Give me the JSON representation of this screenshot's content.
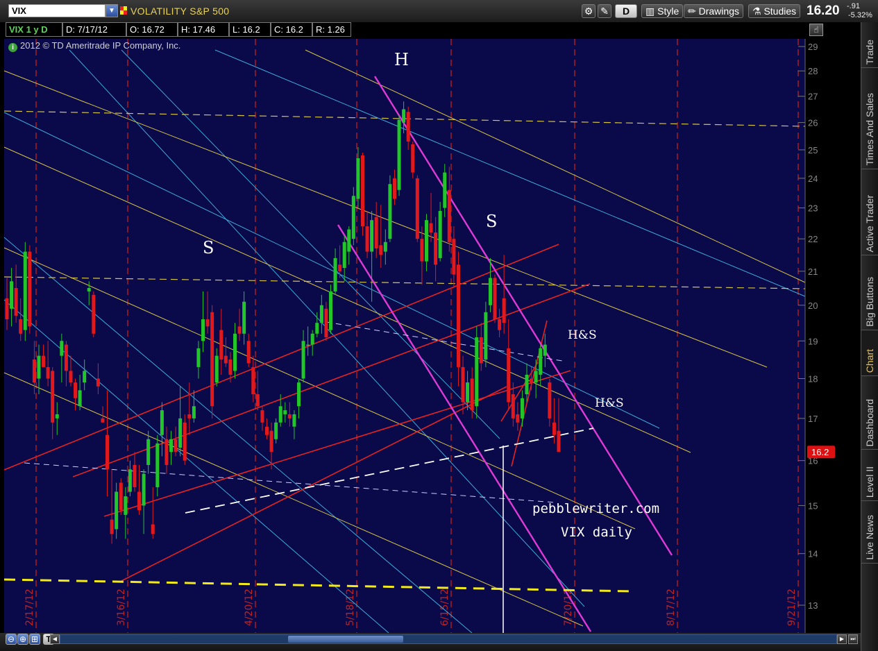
{
  "toolbar": {
    "symbol": "VIX",
    "symbol_description": "VOLATILITY S&P 500",
    "aggregation": "D",
    "style_label": "Style",
    "drawings_label": "Drawings",
    "studies_label": "Studies",
    "last_price": "16.20",
    "net_change": "-.91",
    "pct_change": "-5.32%"
  },
  "info_bar": {
    "period": "VIX 1 y D",
    "date": "D: 7/17/12",
    "open": "O: 16.72",
    "high": "H: 17.46",
    "low": "L: 16.2",
    "close": "C: 16.2",
    "range": "R: 1.26"
  },
  "copyright": "2012 © TD Ameritrade IP Company, Inc.",
  "sidebar_tabs": [
    {
      "label": "Trade",
      "active": false
    },
    {
      "label": "Times And Sales",
      "active": false
    },
    {
      "label": "Active Trader",
      "active": false
    },
    {
      "label": "Big Buttons",
      "active": false
    },
    {
      "label": "Chart",
      "active": true
    },
    {
      "label": "Dashboard",
      "active": false
    },
    {
      "label": "Level II",
      "active": false
    },
    {
      "label": "Live News",
      "active": false
    }
  ],
  "chart_data": {
    "type": "candlestick",
    "y_axis": {
      "min": 13,
      "max": 29,
      "scale": "log",
      "ticks": [
        13,
        14,
        15,
        16,
        17,
        18,
        19,
        20,
        21,
        22,
        23,
        24,
        25,
        26,
        27,
        28,
        29
      ]
    },
    "x_axis": {
      "month_labels": [
        "Mar",
        "Apr",
        "May",
        "Jun",
        "Jul",
        "Aug",
        "Sep"
      ]
    },
    "expiration_dates": [
      "2/17/12",
      "3/16/12",
      "4/20/12",
      "5/18/12",
      "6/15/12",
      "7/20/12",
      "8/17/12",
      "9/21/12"
    ],
    "current_price_label": "16.2",
    "candles": [
      {
        "o": 20.2,
        "h": 20.8,
        "l": 19.3,
        "c": 19.6
      },
      {
        "o": 19.9,
        "h": 21.1,
        "l": 19.4,
        "c": 20.7
      },
      {
        "o": 20.5,
        "h": 21.2,
        "l": 19.5,
        "c": 19.7
      },
      {
        "o": 19.6,
        "h": 20.2,
        "l": 19.0,
        "c": 19.2
      },
      {
        "o": 19.3,
        "h": 21.9,
        "l": 19.0,
        "c": 21.6
      },
      {
        "o": 21.6,
        "h": 21.8,
        "l": 19.2,
        "c": 19.4
      },
      {
        "o": 18.5,
        "h": 19.0,
        "l": 17.6,
        "c": 17.9
      },
      {
        "o": 18.0,
        "h": 18.9,
        "l": 17.6,
        "c": 18.6
      },
      {
        "o": 18.6,
        "h": 18.9,
        "l": 18.3,
        "c": 18.3
      },
      {
        "o": 18.3,
        "h": 19.0,
        "l": 17.8,
        "c": 18.0
      },
      {
        "o": 18.2,
        "h": 18.3,
        "l": 16.5,
        "c": 16.9
      },
      {
        "o": 17.0,
        "h": 17.4,
        "l": 16.6,
        "c": 17.1
      },
      {
        "o": 18.6,
        "h": 19.2,
        "l": 17.9,
        "c": 19.0
      },
      {
        "o": 18.9,
        "h": 19.0,
        "l": 17.8,
        "c": 18.2
      },
      {
        "o": 18.2,
        "h": 18.6,
        "l": 17.8,
        "c": 17.9
      },
      {
        "o": 17.9,
        "h": 18.0,
        "l": 17.2,
        "c": 17.5
      },
      {
        "o": 17.3,
        "h": 18.1,
        "l": 17.2,
        "c": 17.7
      },
      {
        "o": 17.9,
        "h": 18.5,
        "l": 17.7,
        "c": 18.2
      },
      {
        "o": 20.4,
        "h": 20.7,
        "l": 20.0,
        "c": 20.5
      },
      {
        "o": 20.3,
        "h": 20.4,
        "l": 19.1,
        "c": 19.2
      },
      {
        "o": 18.0,
        "h": 18.4,
        "l": 17.6,
        "c": 17.8
      },
      {
        "o": 17.0,
        "h": 17.3,
        "l": 16.9,
        "c": 16.9
      },
      {
        "o": 16.6,
        "h": 17.7,
        "l": 15.2,
        "c": 15.8
      },
      {
        "o": 14.7,
        "h": 15.8,
        "l": 14.2,
        "c": 14.4
      },
      {
        "o": 14.5,
        "h": 15.5,
        "l": 14.3,
        "c": 15.3
      },
      {
        "o": 15.5,
        "h": 15.6,
        "l": 14.8,
        "c": 14.9
      },
      {
        "o": 14.8,
        "h": 15.4,
        "l": 14.3,
        "c": 15.2
      },
      {
        "o": 15.3,
        "h": 16.0,
        "l": 15.2,
        "c": 15.8
      },
      {
        "o": 15.9,
        "h": 16.2,
        "l": 15.3,
        "c": 15.4
      },
      {
        "o": 15.3,
        "h": 15.9,
        "l": 14.8,
        "c": 14.9
      },
      {
        "o": 15.0,
        "h": 15.8,
        "l": 14.4,
        "c": 15.7
      },
      {
        "o": 15.9,
        "h": 16.7,
        "l": 15.7,
        "c": 16.5
      },
      {
        "o": 14.6,
        "h": 15.4,
        "l": 14.3,
        "c": 14.4
      },
      {
        "o": 15.4,
        "h": 16.6,
        "l": 15.2,
        "c": 16.4
      },
      {
        "o": 16.6,
        "h": 17.4,
        "l": 16.1,
        "c": 17.2
      },
      {
        "o": 16.5,
        "h": 16.8,
        "l": 15.7,
        "c": 15.9
      },
      {
        "o": 16.2,
        "h": 16.7,
        "l": 15.9,
        "c": 16.5
      },
      {
        "o": 16.5,
        "h": 16.8,
        "l": 16.1,
        "c": 16.2
      },
      {
        "o": 16.3,
        "h": 17.8,
        "l": 16.1,
        "c": 17.0
      },
      {
        "o": 16.9,
        "h": 17.1,
        "l": 15.9,
        "c": 16.0
      },
      {
        "o": 17.1,
        "h": 17.9,
        "l": 16.6,
        "c": 17.0
      },
      {
        "o": 17.0,
        "h": 17.7,
        "l": 16.9,
        "c": 17.3
      },
      {
        "o": 18.3,
        "h": 19.0,
        "l": 18.0,
        "c": 18.8
      },
      {
        "o": 19.0,
        "h": 20.4,
        "l": 18.7,
        "c": 19.6
      },
      {
        "o": 19.6,
        "h": 20.4,
        "l": 19.2,
        "c": 19.4
      },
      {
        "o": 19.8,
        "h": 20.0,
        "l": 17.0,
        "c": 17.3
      },
      {
        "o": 17.9,
        "h": 18.8,
        "l": 17.8,
        "c": 18.6
      },
      {
        "o": 19.3,
        "h": 19.9,
        "l": 18.1,
        "c": 18.5
      },
      {
        "o": 18.6,
        "h": 19.1,
        "l": 18.3,
        "c": 18.4
      },
      {
        "o": 18.5,
        "h": 18.7,
        "l": 17.9,
        "c": 18.1
      },
      {
        "o": 18.2,
        "h": 19.5,
        "l": 18.0,
        "c": 19.2
      },
      {
        "o": 19.4,
        "h": 19.9,
        "l": 19.0,
        "c": 19.2
      },
      {
        "o": 19.2,
        "h": 20.4,
        "l": 18.9,
        "c": 20.1
      },
      {
        "o": 19.0,
        "h": 19.2,
        "l": 18.3,
        "c": 18.4
      },
      {
        "o": 18.3,
        "h": 18.6,
        "l": 17.4,
        "c": 17.6
      },
      {
        "o": 17.6,
        "h": 18.2,
        "l": 17.2,
        "c": 17.3
      },
      {
        "o": 17.2,
        "h": 17.3,
        "l": 16.7,
        "c": 16.9
      },
      {
        "o": 16.8,
        "h": 17.0,
        "l": 16.5,
        "c": 16.6
      },
      {
        "o": 16.7,
        "h": 16.9,
        "l": 15.8,
        "c": 16.2
      },
      {
        "o": 16.5,
        "h": 17.0,
        "l": 16.4,
        "c": 16.9
      },
      {
        "o": 16.9,
        "h": 17.6,
        "l": 16.8,
        "c": 17.3
      },
      {
        "o": 17.1,
        "h": 17.4,
        "l": 16.9,
        "c": 17.2
      },
      {
        "o": 17.1,
        "h": 17.4,
        "l": 16.8,
        "c": 17.0
      },
      {
        "o": 16.8,
        "h": 17.2,
        "l": 16.5,
        "c": 17.1
      },
      {
        "o": 17.3,
        "h": 18.0,
        "l": 17.0,
        "c": 17.9
      },
      {
        "o": 18.0,
        "h": 19.3,
        "l": 17.9,
        "c": 19.0
      },
      {
        "o": 18.9,
        "h": 19.4,
        "l": 18.6,
        "c": 18.9
      },
      {
        "o": 18.9,
        "h": 19.3,
        "l": 18.6,
        "c": 19.2
      },
      {
        "o": 19.2,
        "h": 19.8,
        "l": 19.1,
        "c": 19.5
      },
      {
        "o": 19.5,
        "h": 20.3,
        "l": 19.2,
        "c": 20.0
      },
      {
        "o": 19.9,
        "h": 20.1,
        "l": 19.0,
        "c": 19.1
      },
      {
        "o": 19.3,
        "h": 20.6,
        "l": 19.2,
        "c": 20.4
      },
      {
        "o": 20.4,
        "h": 21.7,
        "l": 20.3,
        "c": 21.4
      },
      {
        "o": 21.2,
        "h": 21.8,
        "l": 20.8,
        "c": 21.0
      },
      {
        "o": 21.1,
        "h": 22.1,
        "l": 20.7,
        "c": 21.9
      },
      {
        "o": 21.6,
        "h": 22.4,
        "l": 21.2,
        "c": 22.3
      },
      {
        "o": 22.0,
        "h": 23.7,
        "l": 21.8,
        "c": 23.4
      },
      {
        "o": 23.3,
        "h": 25.1,
        "l": 23.0,
        "c": 24.7
      },
      {
        "o": 24.8,
        "h": 24.9,
        "l": 22.1,
        "c": 22.4
      },
      {
        "o": 22.4,
        "h": 22.9,
        "l": 21.4,
        "c": 21.6
      },
      {
        "o": 21.6,
        "h": 22.9,
        "l": 20.1,
        "c": 22.6
      },
      {
        "o": 22.7,
        "h": 23.2,
        "l": 21.4,
        "c": 21.7
      },
      {
        "o": 21.8,
        "h": 23.1,
        "l": 21.1,
        "c": 21.5
      },
      {
        "o": 21.6,
        "h": 22.3,
        "l": 21.2,
        "c": 21.9
      },
      {
        "o": 22.0,
        "h": 24.1,
        "l": 21.9,
        "c": 23.8
      },
      {
        "o": 24.0,
        "h": 24.3,
        "l": 23.1,
        "c": 23.3
      },
      {
        "o": 23.6,
        "h": 26.3,
        "l": 23.4,
        "c": 26.1
      },
      {
        "o": 26.0,
        "h": 26.8,
        "l": 25.6,
        "c": 26.5
      },
      {
        "o": 26.4,
        "h": 26.6,
        "l": 25.0,
        "c": 25.3
      },
      {
        "o": 25.2,
        "h": 25.3,
        "l": 24.0,
        "c": 24.2
      },
      {
        "o": 24.0,
        "h": 24.1,
        "l": 21.9,
        "c": 22.0
      },
      {
        "o": 22.0,
        "h": 22.4,
        "l": 20.6,
        "c": 21.3
      },
      {
        "o": 21.3,
        "h": 22.8,
        "l": 21.0,
        "c": 22.6
      },
      {
        "o": 22.5,
        "h": 23.5,
        "l": 21.9,
        "c": 22.2
      },
      {
        "o": 22.2,
        "h": 22.7,
        "l": 20.7,
        "c": 21.2
      },
      {
        "o": 21.4,
        "h": 23.2,
        "l": 21.3,
        "c": 22.9
      },
      {
        "o": 23.0,
        "h": 24.5,
        "l": 22.7,
        "c": 24.2
      },
      {
        "o": 23.6,
        "h": 24.4,
        "l": 21.6,
        "c": 21.9
      },
      {
        "o": 22.0,
        "h": 22.4,
        "l": 20.5,
        "c": 20.9
      },
      {
        "o": 21.2,
        "h": 21.6,
        "l": 17.8,
        "c": 18.3
      },
      {
        "o": 18.3,
        "h": 18.6,
        "l": 17.1,
        "c": 17.4
      },
      {
        "o": 17.4,
        "h": 18.2,
        "l": 17.2,
        "c": 17.9
      },
      {
        "o": 18.0,
        "h": 18.3,
        "l": 17.0,
        "c": 17.2
      },
      {
        "o": 17.3,
        "h": 19.4,
        "l": 17.0,
        "c": 19.1
      },
      {
        "o": 19.1,
        "h": 19.5,
        "l": 18.2,
        "c": 18.4
      },
      {
        "o": 18.5,
        "h": 20.1,
        "l": 18.3,
        "c": 19.8
      },
      {
        "o": 20.0,
        "h": 21.4,
        "l": 19.8,
        "c": 20.8
      },
      {
        "o": 20.8,
        "h": 20.9,
        "l": 19.5,
        "c": 19.6
      },
      {
        "o": 19.6,
        "h": 19.9,
        "l": 19.1,
        "c": 19.3
      },
      {
        "o": 20.2,
        "h": 21.5,
        "l": 19.2,
        "c": 19.5
      },
      {
        "o": 18.8,
        "h": 19.6,
        "l": 17.2,
        "c": 17.4
      },
      {
        "o": 17.6,
        "h": 17.9,
        "l": 16.8,
        "c": 17.0
      },
      {
        "o": 17.1,
        "h": 17.4,
        "l": 16.7,
        "c": 16.9
      },
      {
        "o": 17.0,
        "h": 17.7,
        "l": 16.8,
        "c": 17.5
      },
      {
        "o": 17.6,
        "h": 18.4,
        "l": 17.4,
        "c": 18.1
      },
      {
        "o": 18.0,
        "h": 18.3,
        "l": 17.7,
        "c": 17.9
      },
      {
        "o": 17.9,
        "h": 18.5,
        "l": 17.5,
        "c": 18.2
      },
      {
        "o": 18.1,
        "h": 18.9,
        "l": 17.8,
        "c": 18.8
      },
      {
        "o": 18.6,
        "h": 19.2,
        "l": 18.3,
        "c": 18.9
      },
      {
        "o": 17.9,
        "h": 18.0,
        "l": 16.8,
        "c": 17.0
      },
      {
        "o": 16.9,
        "h": 17.5,
        "l": 16.4,
        "c": 16.6
      },
      {
        "o": 16.7,
        "h": 17.5,
        "l": 16.2,
        "c": 16.2
      }
    ],
    "annotations": [
      {
        "text": "H"
      },
      {
        "text": "S"
      },
      {
        "text": "S"
      },
      {
        "text": "H&S"
      },
      {
        "text": "H&S"
      },
      {
        "text": "pebblewriter.com"
      },
      {
        "text": "VIX daily"
      }
    ]
  }
}
